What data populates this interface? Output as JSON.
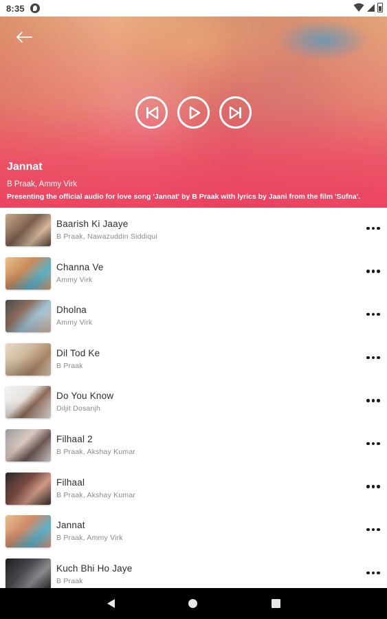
{
  "status_bar": {
    "time": "8:35"
  },
  "now_playing": {
    "title": "Jannat",
    "artists": "B Praak, Ammy Virk",
    "description": "Presenting the official audio for love song 'Jannat' by B Praak  with lyrics by Jaani from the film 'Sufna'."
  },
  "icons": {
    "back": "back-arrow-icon",
    "previous": "skip-previous-icon",
    "play": "play-icon",
    "next": "skip-next-icon",
    "more": "more-horizontal-icon"
  },
  "songs": [
    {
      "title": "Baarish Ki Jaaye",
      "artist": "B Praak, Nawazuddin Siddiqui"
    },
    {
      "title": "Channa Ve",
      "artist": "Ammy Virk"
    },
    {
      "title": "Dholna",
      "artist": "Ammy Virk"
    },
    {
      "title": "Dil Tod Ke",
      "artist": "B Praak"
    },
    {
      "title": "Do You Know",
      "artist": "Diljit Dosanjh"
    },
    {
      "title": "Filhaal 2",
      "artist": "B Praak, Akshay Kumar"
    },
    {
      "title": "Filhaal",
      "artist": "B Praak, Akshay Kumar"
    },
    {
      "title": "Jannat",
      "artist": "B Praak, Ammy Virk"
    },
    {
      "title": "Kuch Bhi Ho Jaye",
      "artist": "B Praak"
    }
  ],
  "colors": {
    "accent": "#ec3e60",
    "title_text": "#2d2d2d",
    "subtitle_text": "#8a8a8a"
  }
}
